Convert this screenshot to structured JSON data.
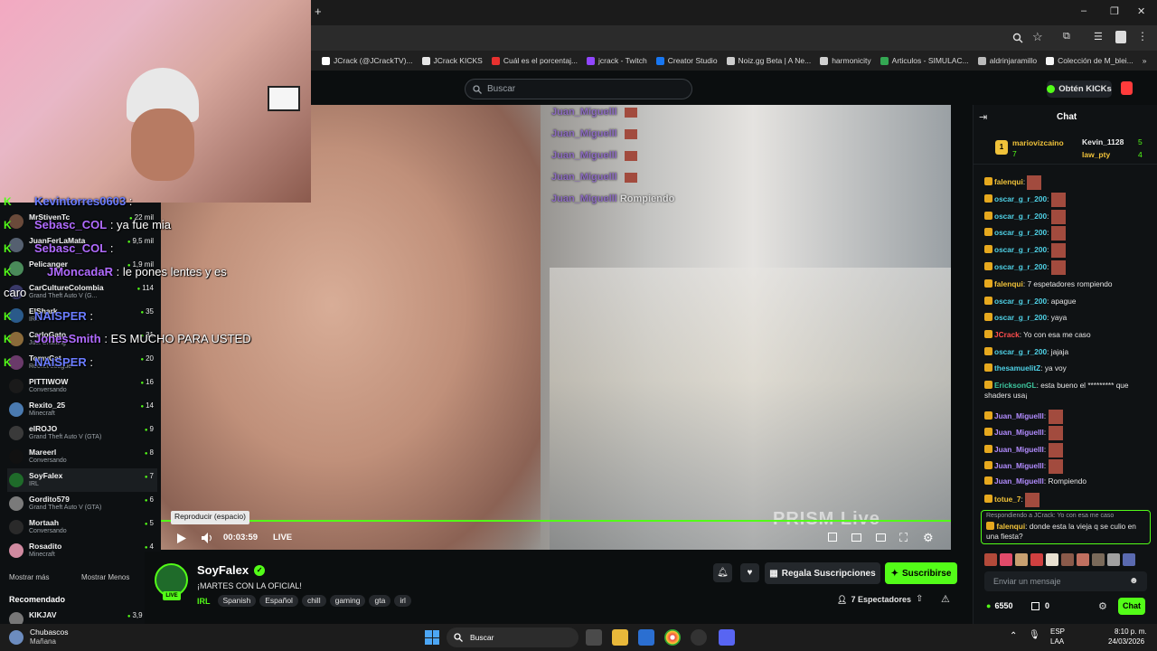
{
  "browser": {
    "new_tab": "+",
    "window_controls": [
      "–",
      "❐",
      "✕"
    ],
    "bookmarks": [
      {
        "label": "JCrack (@JCrackTV)...",
        "color": "#ffffff"
      },
      {
        "label": "JCrack KICKS",
        "color": "#e6e6e6"
      },
      {
        "label": "Cuál es el porcentaj...",
        "color": "#e8312f"
      },
      {
        "label": "jcrack - Twitch",
        "color": "#9146ff"
      },
      {
        "label": "Creator Studio",
        "color": "#1877f2"
      },
      {
        "label": "Noiz.gg Beta | A Ne...",
        "color": "#cccccc"
      },
      {
        "label": "harmonicity",
        "color": "#d0d0d0"
      },
      {
        "label": "Articulos - SIMULAC...",
        "color": "#34a853"
      },
      {
        "label": "aldrinjaramillo",
        "color": "#bbbbbb"
      },
      {
        "label": "Colección de M_blei...",
        "color": "#f5f5f5"
      }
    ],
    "bookmarks_more": "»"
  },
  "header": {
    "search_placeholder": "Buscar",
    "kicks_button": "Obtén KICKs"
  },
  "overlay_chat": [
    {
      "user": "Kevintorres0603",
      "text": ":",
      "user_class": "u"
    },
    {
      "user": "Sebasc_COL",
      "text": ": ya fue mia",
      "user_class": "u2"
    },
    {
      "user": "Sebasc_COL",
      "text": ":",
      "user_class": "u2"
    },
    {
      "user": "JMoncadaR",
      "text": ": le pones lentes y es",
      "user_class": "u2"
    },
    {
      "user": "",
      "text": "caro",
      "user_class": "u"
    },
    {
      "user": "NAISPER",
      "text": ":",
      "user_class": "u"
    },
    {
      "user": "JonesSmith",
      "text": ": ES MUCHO PARA USTED",
      "user_class": "u2"
    },
    {
      "user": "NAISPER",
      "text": ":",
      "user_class": "u"
    }
  ],
  "sidebar": {
    "channels": [
      {
        "name": "MrStivenTc",
        "category": "",
        "count": "22 mil",
        "color": "#6a4a3a"
      },
      {
        "name": "JuanFerLaMata",
        "category": "",
        "count": "9,5 mil",
        "color": "#556070"
      },
      {
        "name": "Pelicanger",
        "category": "",
        "count": "1,9 mil",
        "color": "#4a8a5a"
      },
      {
        "name": "CarCultureColombia",
        "category": "Grand Theft Auto V (G...",
        "count": "114",
        "color": "#3a3a6a"
      },
      {
        "name": "ElShark",
        "category": "IRL",
        "count": "35",
        "color": "#2a5a8a"
      },
      {
        "name": "CarloGato",
        "category": "Just Chatting",
        "count": "31",
        "color": "#8a6a3a"
      },
      {
        "name": "TomyCat",
        "category": "Rocket League",
        "count": "20",
        "color": "#6a3a6a"
      },
      {
        "name": "PITTIWOW",
        "category": "Conversando",
        "count": "16",
        "color": "#1a1a1a"
      },
      {
        "name": "Rexito_25",
        "category": "Minecraft",
        "count": "14",
        "color": "#4a7ab0"
      },
      {
        "name": "elROJO",
        "category": "Grand Theft Auto V (GTA)",
        "count": "9",
        "color": "#3a3a3a"
      },
      {
        "name": "Mareerl",
        "category": "Conversando",
        "count": "8",
        "color": "#111111"
      },
      {
        "name": "SoyFalex",
        "category": "IRL",
        "count": "7",
        "color": "#1f6b2a"
      },
      {
        "name": "Gordito579",
        "category": "Grand Theft Auto V (GTA)",
        "count": "6",
        "color": "#7a7a7a"
      },
      {
        "name": "Mortaah",
        "category": "Conversando",
        "count": "5",
        "color": "#2a2a2a"
      },
      {
        "name": "Rosadito",
        "category": "Minecraft",
        "count": "4",
        "color": "#d08aa0"
      }
    ],
    "show_more": "Mostrar más",
    "show_less": "Mostrar Menos",
    "recommended_heading": "Recomendado",
    "recommended": [
      {
        "name": "KIKJAV",
        "count": "3,9 mil"
      }
    ]
  },
  "video": {
    "chat_lines": [
      {
        "user": "Juan_Miguelll",
        "text": ""
      },
      {
        "user": "Juan_Miguelll",
        "text": ""
      },
      {
        "user": "Juan_Miguelll",
        "text": ""
      },
      {
        "user": "Juan_Miguelll",
        "text": ""
      },
      {
        "user": "Juan_Miguelll",
        "text": "Rompiendo"
      }
    ],
    "watermark": "PRISM Live",
    "tooltip": "Reproducir (espacio)",
    "time": "00:03:59",
    "live_label": "LIVE"
  },
  "stream": {
    "streamer": "SoyFalex",
    "live_badge": "LIVE",
    "title": "¡MARTES CON LA OFICIAL!",
    "category": "IRL",
    "tags": [
      "Spanish",
      "Español",
      "chill",
      "gaming",
      "gta",
      "irl"
    ],
    "gift_label": "Regala Suscripciones",
    "subscribe_label": "Suscribirse",
    "viewers": "7 Espectadores"
  },
  "chat": {
    "title": "Chat",
    "leaderboard": [
      {
        "rank": "1",
        "name": "mariovizcaino",
        "value": "7"
      },
      {
        "rank": "",
        "name": "Kevin_1128",
        "value": "5"
      },
      {
        "rank": "",
        "name": "law_pty",
        "value": "4"
      }
    ],
    "messages": [
      {
        "user": "falenqui",
        "text": "",
        "cls": "yel",
        "emote": true
      },
      {
        "user": "oscar_g_r_200",
        "text": "",
        "cls": "cyan",
        "emote": true
      },
      {
        "user": "oscar_g_r_200",
        "text": "",
        "cls": "cyan",
        "emote": true
      },
      {
        "user": "oscar_g_r_200",
        "text": "",
        "cls": "cyan",
        "emote": true
      },
      {
        "user": "oscar_g_r_200",
        "text": "",
        "cls": "cyan",
        "emote": true
      },
      {
        "user": "oscar_g_r_200",
        "text": "",
        "cls": "cyan",
        "emote": true
      },
      {
        "user": "falenqui",
        "text": "7 espetadores rompiendo",
        "cls": "yel",
        "emote": false
      },
      {
        "user": "oscar_g_r_200",
        "text": "apague",
        "cls": "cyan",
        "emote": false
      },
      {
        "user": "oscar_g_r_200",
        "text": "yaya",
        "cls": "cyan",
        "emote": false
      },
      {
        "user": "JCrack",
        "text": "Yo con esa me caso",
        "cls": "red",
        "emote": false
      },
      {
        "user": "oscar_g_r_200",
        "text": "jajaja",
        "cls": "cyan",
        "emote": false
      },
      {
        "user": "thesamuelitZ",
        "text": "ya voy",
        "cls": "cyan",
        "emote": false
      },
      {
        "user": "EricksonGL",
        "text": "esta bueno el ********* que shaders usa¡",
        "cls": "grn",
        "emote": false
      },
      {
        "user": "Juan_Miguelll",
        "text": "",
        "cls": "pur",
        "emote": true
      },
      {
        "user": "Juan_Miguelll",
        "text": "",
        "cls": "pur",
        "emote": true
      },
      {
        "user": "Juan_Miguelll",
        "text": "",
        "cls": "pur",
        "emote": true
      },
      {
        "user": "Juan_Miguelll",
        "text": "",
        "cls": "pur",
        "emote": true
      },
      {
        "user": "Juan_Miguelll",
        "text": "Rompiendo",
        "cls": "pur",
        "emote": false
      },
      {
        "user": "totue_7",
        "text": "",
        "cls": "yel",
        "emote": true
      }
    ],
    "reply_context": "Respondiendo a JCrack: Yo con esa me caso",
    "reply_user": "falenqui",
    "reply_text": "donde esta la vieja q se culio en una fiesta?",
    "input_placeholder": "Enviar un mensaje",
    "kicks_balance": "6550",
    "points": "0",
    "chat_button": "Chat"
  },
  "taskbar": {
    "weather_title": "Chubascos",
    "weather_sub": "Mañana",
    "search_label": "Buscar",
    "lang_top": "ESP",
    "lang_bottom": "LAA",
    "time": "8:10 p. m.",
    "date": "24/03/2026"
  }
}
